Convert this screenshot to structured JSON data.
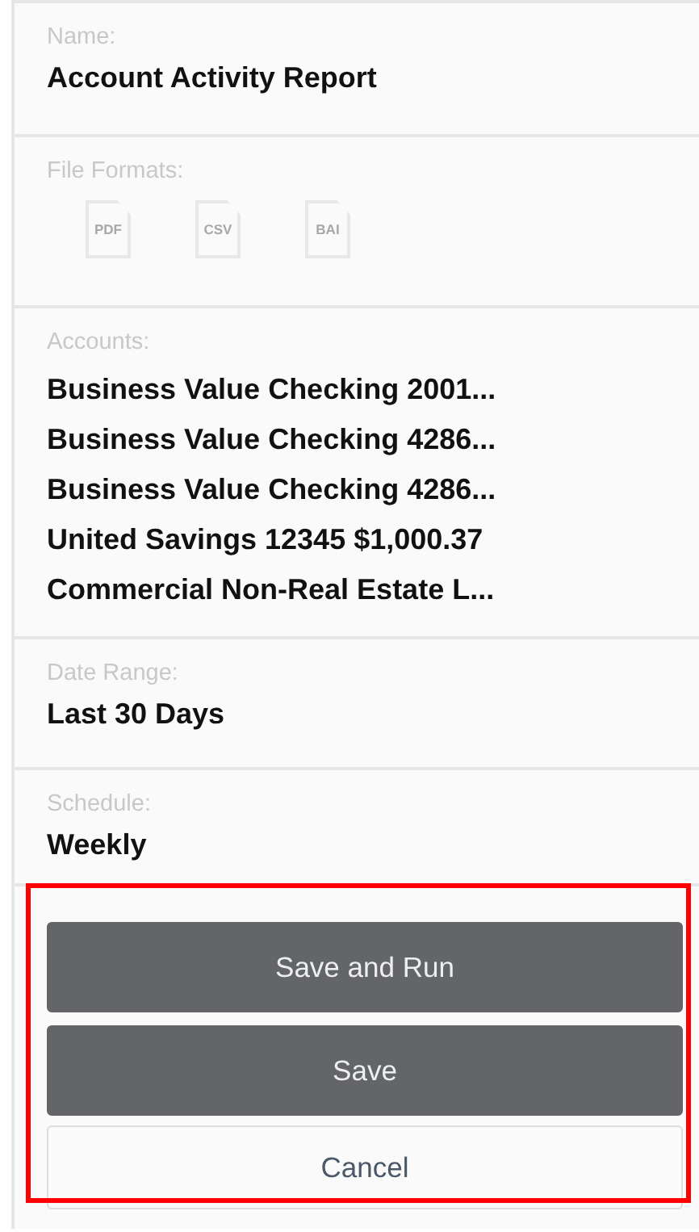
{
  "name": {
    "label": "Name:",
    "value": "Account Activity Report"
  },
  "file_formats": {
    "label": "File Formats:",
    "items": [
      {
        "label": "PDF"
      },
      {
        "label": "CSV"
      },
      {
        "label": "BAI"
      }
    ]
  },
  "accounts": {
    "label": "Accounts:",
    "items": [
      "Business Value Checking 2001...",
      "Business Value Checking 4286...",
      "Business Value Checking 4286...",
      "United Savings 12345 $1,000.37",
      "Commercial Non-Real Estate L..."
    ]
  },
  "date_range": {
    "label": "Date Range:",
    "value": "Last 30 Days"
  },
  "schedule": {
    "label": "Schedule:",
    "value": "Weekly"
  },
  "actions": {
    "highlighted": true,
    "buttons": [
      {
        "label": "Save and Run",
        "kind": "primary"
      },
      {
        "label": "Save",
        "kind": "primary"
      },
      {
        "label": "Cancel",
        "kind": "secondary"
      }
    ]
  }
}
